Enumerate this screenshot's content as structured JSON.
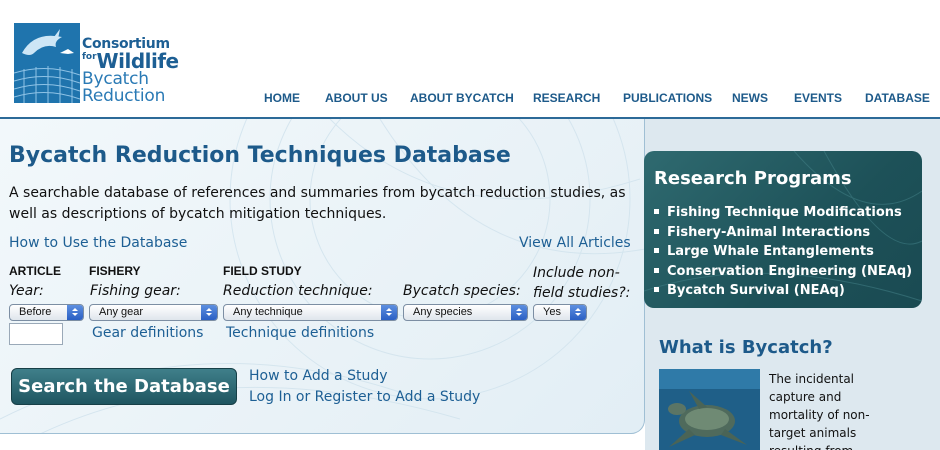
{
  "logo": {
    "line1": "Consortium",
    "line2_small": "for",
    "line2_big": "Wildlife",
    "line3": "Bycatch",
    "line4": "Reduction"
  },
  "nav": {
    "items": [
      "HOME",
      "ABOUT US",
      "ABOUT BYCATCH",
      "RESEARCH",
      "PUBLICATIONS",
      "NEWS",
      "EVENTS",
      "DATABASE"
    ]
  },
  "main": {
    "title": "Bycatch Reduction Techniques Database",
    "intro": "A searchable database of references and summaries from bycatch reduction studies, as well as descriptions of bycatch mitigation techniques.",
    "how_to_use_link": "How to Use the Database",
    "view_all_link": "View All Articles",
    "filters": {
      "article_head": "ARTICLE",
      "year_label": "Year:",
      "year_select": "Before",
      "year_input": "",
      "fishery_head": "FISHERY",
      "gear_label": "Fishing gear:",
      "gear_select": "Any gear",
      "gear_defs_link": "Gear definitions",
      "field_head": "FIELD STUDY",
      "technique_label": "Reduction technique:",
      "technique_select": "Any technique",
      "technique_defs_link": "Technique definitions",
      "species_label": "Bycatch species:",
      "species_select": "Any species",
      "include_label_1": "Include non-",
      "include_label_2": "field studies?:",
      "include_select": "Yes"
    },
    "search_button": "Search the Database",
    "add_study_link": "How to Add a Study",
    "login_link": "Log In or Register to Add a Study"
  },
  "sidebar": {
    "research_title": "Research Programs",
    "research_items": [
      "Fishing Technique Modifications",
      "Fishery-Animal Interactions",
      "Large Whale Entanglements",
      "Conservation Engineering (NEAq)",
      "Bycatch Survival (NEAq)"
    ],
    "what_title": "What is Bycatch?",
    "what_text": "The incidental capture and mortality of non-target animals resulting from"
  },
  "colors": {
    "brand_blue": "#1d5a8a",
    "teal_box": "#1d5158",
    "sidebar_bg": "#dde8ef"
  }
}
